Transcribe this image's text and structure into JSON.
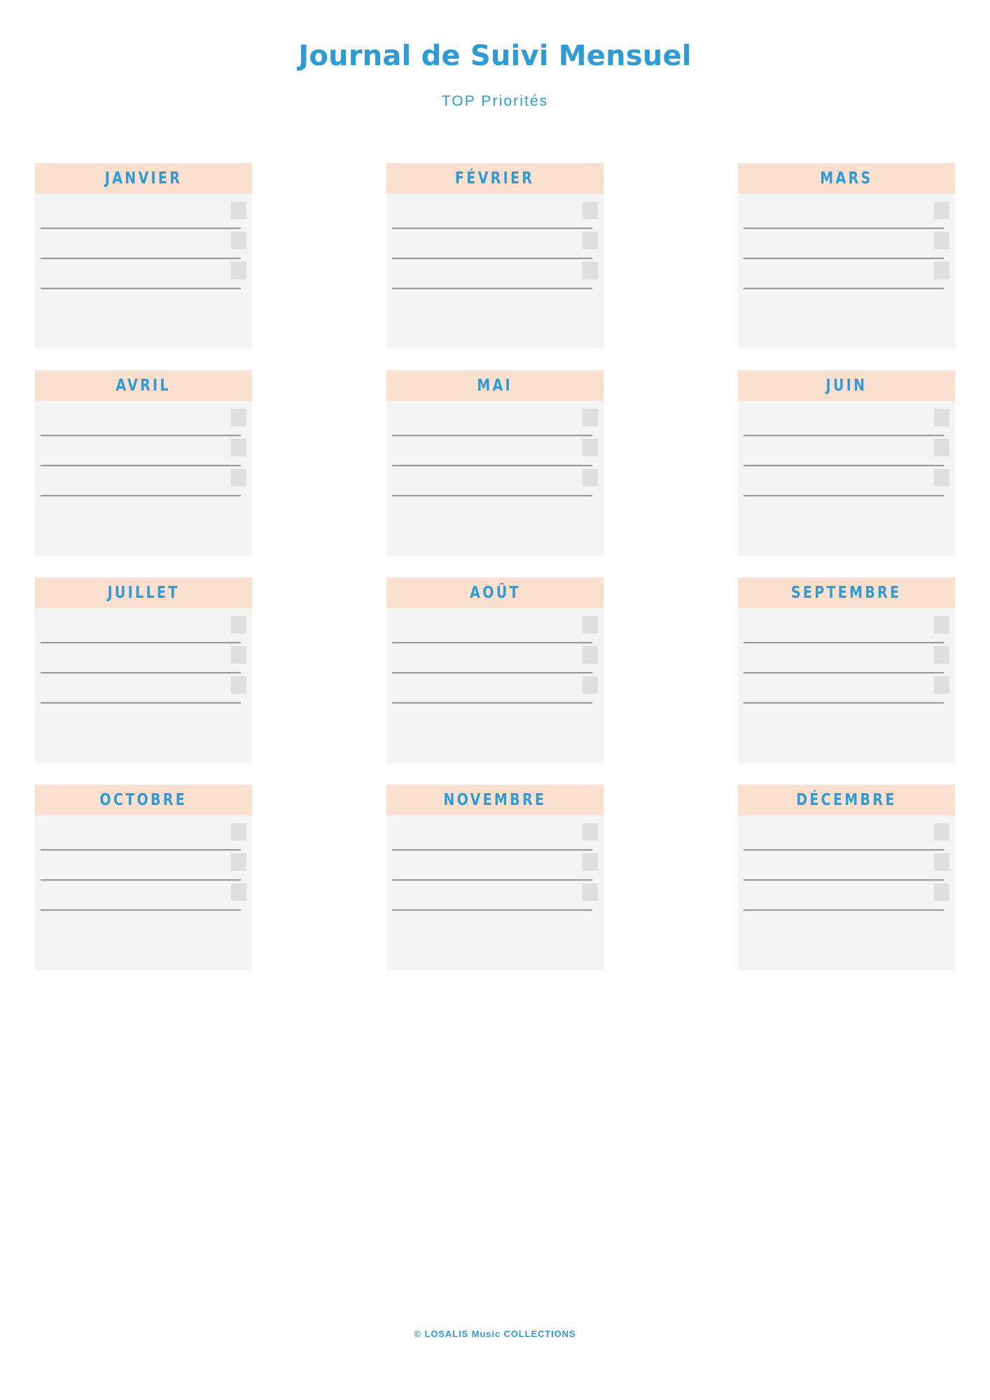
{
  "header": {
    "title": "Journal de Suivi Mensuel",
    "subtitle": "TOP Priorités"
  },
  "grid": {
    "columns": 3,
    "rows": 4,
    "priorities_per_month": 3,
    "colors": {
      "month_header_bg": "#FBE0D0",
      "card_bg": "#F5F4F5",
      "accent_blue": "#2F9BD4",
      "checkbox": "#DEDEDE",
      "rule_line": "#9B9B9B",
      "page_bg": "#FFFFFF"
    },
    "months": [
      {
        "label": "JANVIER"
      },
      {
        "label": "FÉVRIER"
      },
      {
        "label": "MARS"
      },
      {
        "label": "AVRIL"
      },
      {
        "label": "MAI"
      },
      {
        "label": "JUIN"
      },
      {
        "label": "JUILLET"
      },
      {
        "label": "AOÛT"
      },
      {
        "label": "SEPTEMBRE"
      },
      {
        "label": "OCTOBRE"
      },
      {
        "label": "NOVEMBRE"
      },
      {
        "label": "DÉCEMBRE"
      }
    ]
  },
  "footer": {
    "copyright": "© LOSALIS Music COLLECTIONS"
  }
}
